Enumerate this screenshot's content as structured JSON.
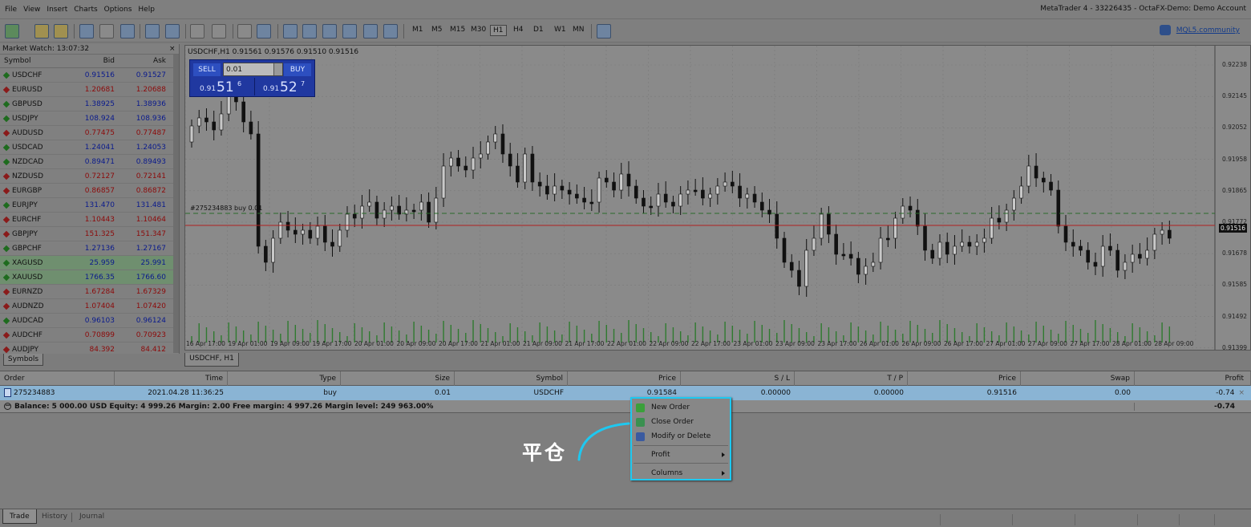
{
  "menu": [
    "File",
    "View",
    "Insert",
    "Charts",
    "Options",
    "Help"
  ],
  "window_title": "MetaTrader 4 - 33226435 - OctaFX-Demo: Demo Account",
  "timeframes": [
    "M1",
    "M5",
    "M15",
    "M30",
    "H1",
    "H4",
    "D1",
    "W1",
    "MN"
  ],
  "active_timeframe": "H1",
  "mql_link": "MQL5.community",
  "market_watch": {
    "title": "Market Watch: 13:07:32",
    "headers": {
      "symbol": "Symbol",
      "bid": "Bid",
      "ask": "Ask"
    },
    "rows": [
      {
        "symbol": "USDCHF",
        "bid": "0.91516",
        "ask": "0.91527",
        "dir": "up",
        "color": "blue"
      },
      {
        "symbol": "EURUSD",
        "bid": "1.20681",
        "ask": "1.20688",
        "dir": "dn",
        "color": "red"
      },
      {
        "symbol": "GBPUSD",
        "bid": "1.38925",
        "ask": "1.38936",
        "dir": "up",
        "color": "blue"
      },
      {
        "symbol": "USDJPY",
        "bid": "108.924",
        "ask": "108.936",
        "dir": "up",
        "color": "blue"
      },
      {
        "symbol": "AUDUSD",
        "bid": "0.77475",
        "ask": "0.77487",
        "dir": "dn",
        "color": "red"
      },
      {
        "symbol": "USDCAD",
        "bid": "1.24041",
        "ask": "1.24053",
        "dir": "up",
        "color": "blue"
      },
      {
        "symbol": "NZDCAD",
        "bid": "0.89471",
        "ask": "0.89493",
        "dir": "up",
        "color": "blue"
      },
      {
        "symbol": "NZDUSD",
        "bid": "0.72127",
        "ask": "0.72141",
        "dir": "dn",
        "color": "red"
      },
      {
        "symbol": "EURGBP",
        "bid": "0.86857",
        "ask": "0.86872",
        "dir": "dn",
        "color": "red"
      },
      {
        "symbol": "EURJPY",
        "bid": "131.470",
        "ask": "131.481",
        "dir": "up",
        "color": "blue"
      },
      {
        "symbol": "EURCHF",
        "bid": "1.10443",
        "ask": "1.10464",
        "dir": "dn",
        "color": "red"
      },
      {
        "symbol": "GBPJPY",
        "bid": "151.325",
        "ask": "151.347",
        "dir": "dn",
        "color": "red"
      },
      {
        "symbol": "GBPCHF",
        "bid": "1.27136",
        "ask": "1.27167",
        "dir": "up",
        "color": "blue"
      },
      {
        "symbol": "XAGUSD",
        "bid": "25.959",
        "ask": "25.991",
        "dir": "up",
        "color": "blue",
        "highlight": true
      },
      {
        "symbol": "XAUUSD",
        "bid": "1766.35",
        "ask": "1766.60",
        "dir": "up",
        "color": "blue",
        "highlight": true
      },
      {
        "symbol": "EURNZD",
        "bid": "1.67284",
        "ask": "1.67329",
        "dir": "dn",
        "color": "red"
      },
      {
        "symbol": "AUDNZD",
        "bid": "1.07404",
        "ask": "1.07420",
        "dir": "dn",
        "color": "red"
      },
      {
        "symbol": "AUDCAD",
        "bid": "0.96103",
        "ask": "0.96124",
        "dir": "up",
        "color": "blue"
      },
      {
        "symbol": "AUDCHF",
        "bid": "0.70899",
        "ask": "0.70923",
        "dir": "dn",
        "color": "red"
      },
      {
        "symbol": "AUDJPY",
        "bid": "84.392",
        "ask": "84.412",
        "dir": "dn",
        "color": "red"
      }
    ],
    "tab": "Symbols"
  },
  "chart": {
    "title": "USDCHF,H1  0.91561 0.91576 0.91510 0.91516",
    "tab": "USDCHF, H1",
    "one_click": {
      "sell": "SELL",
      "buy": "BUY",
      "lot": "0.01",
      "sell_small": "0.91",
      "sell_big": "51",
      "sell_sup": "6",
      "buy_small": "0.91",
      "buy_big": "52",
      "buy_sup": "7"
    },
    "position_label": "#275234883 buy 0.01",
    "current_price": "0.91516",
    "price_axis": [
      "0.92238",
      "0.92145",
      "0.92052",
      "0.91958",
      "0.91865",
      "0.91772",
      "0.91678",
      "0.91585",
      "0.91492",
      "0.91399",
      "0.91305",
      "0.91212",
      "0.91119"
    ],
    "time_axis": [
      "16 Apr 17:00",
      "19 Apr 01:00",
      "19 Apr 09:00",
      "19 Apr 17:00",
      "20 Apr 01:00",
      "20 Apr 09:00",
      "20 Apr 17:00",
      "21 Apr 01:00",
      "21 Apr 09:00",
      "21 Apr 17:00",
      "22 Apr 01:00",
      "22 Apr 09:00",
      "22 Apr 17:00",
      "23 Apr 01:00",
      "23 Apr 09:00",
      "23 Apr 17:00",
      "26 Apr 01:00",
      "26 Apr 09:00",
      "26 Apr 17:00",
      "27 Apr 01:00",
      "27 Apr 09:00",
      "27 Apr 17:00",
      "28 Apr 01:00",
      "28 Apr 09:00"
    ]
  },
  "terminal": {
    "headers": [
      "Order",
      "Time",
      "Type",
      "Size",
      "Symbol",
      "Price",
      "S / L",
      "T / P",
      "Price",
      "Swap",
      "Profit"
    ],
    "row": [
      "275234883",
      "2021.04.28 11:36:25",
      "buy",
      "0.01",
      "USDCHF",
      "0.91584",
      "0.00000",
      "0.00000",
      "0.91516",
      "0.00",
      "-0.74"
    ],
    "balance_text": "Balance: 5 000.00 USD  Equity: 4 999.26  Margin: 2.00  Free margin: 4 997.26  Margin level: 249 963.00%",
    "balance_profit": "-0.74",
    "tabs": [
      "Trade",
      "History",
      "Journal"
    ]
  },
  "context_menu": {
    "items": [
      "New Order",
      "Close Order",
      "Modify or Delete",
      "Profit",
      "Columns"
    ]
  },
  "callout": "平仓",
  "colors": {
    "accent": "#1ec8f0",
    "sell_panel": "#2038a0",
    "order_row": "#8ab4d4"
  }
}
